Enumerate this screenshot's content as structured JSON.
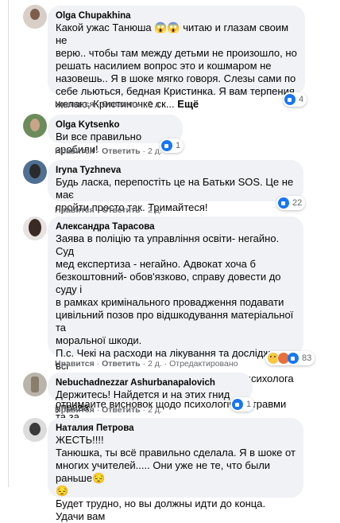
{
  "comments": [
    {
      "author": "Olga Chupakhina",
      "text": "Какой ужас Танюша 😱😱 читаю и глазам своим не\nверю.. чтобы там между детьми не произошло, но\nрешать насилием вопрос это и кошмаром не\nназовешь.. Я в шоке мягко говоря. Слезы сами по\nсебе льються, бедная Кристинка. Я вам терпения\nжелаю, Кристиночке ск...",
      "more": "Ещё",
      "like": "Нравится",
      "reply": "Ответить",
      "time": "2 д.",
      "reactions": "4"
    },
    {
      "author": "Olga Kytsenko",
      "text": "Ви все правильно зробили!",
      "like": "Нравится",
      "reply": "Ответить",
      "time": "2 д.",
      "reactions": "1"
    },
    {
      "author": "Iryna Tyzhneva",
      "text": "Будь ласка, перепостіть це на Батьки SOS. Це не має\nпройти просто так. Тримайтеся!",
      "like": "Нравится",
      "reply": "Ответить",
      "time": "2 д.",
      "reactions": "22"
    },
    {
      "author": "Александра Тарасова",
      "text": "Заява в поліцію та управління освіти- негайно. Суд\nмед експертиза - негайно. Адвокат хоча б\nбезкоштовний- обов'язково, справу довести до суду і\nв рамках кримінального провадження подавати\nцивільний позов про відшкодування матеріальної та\nморальної шкоди.\nП.с. Чекі на расходи на лікування та дослідження всі\nзберігайте. А ще зверніться з часом до психолога -\nотримайте висновок щодо психологічної травми та за\nдопомогою . Все це докази для суду.",
      "like": "Нравится",
      "reply": "Ответить",
      "time": "2 д.",
      "edited": "Отредактировано",
      "reactions": "83"
    },
    {
      "author": "Nebuchadnezzar Ashurbanapalovich",
      "text": "Держитесь! Найдется и на этих гнид управа",
      "like": "Нравится",
      "reply": "Ответить",
      "time": "2 д.",
      "reactions": "1"
    },
    {
      "author": "Наталия Петрова",
      "text": "ЖЕСТЬ!!!!\nТанюшка, ты всё правильно сделала. Я в шоке от\nмногих учителей..... Они уже не те, что были раньше😔\n😔\nБудет трудно, но вы должны идти до конца. Удачи вам"
    }
  ],
  "icons": {
    "like": "like-icon",
    "sad": "sad-icon",
    "angry": "angry-icon",
    "heart": "heart-icon"
  }
}
